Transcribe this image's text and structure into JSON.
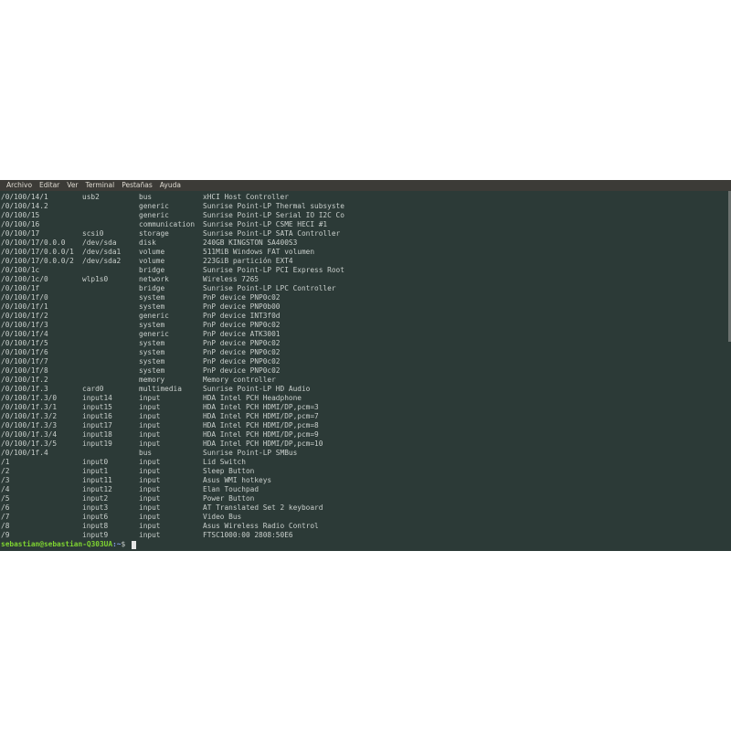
{
  "menu": [
    "Archivo",
    "Editar",
    "Ver",
    "Terminal",
    "Pestañas",
    "Ayuda"
  ],
  "rows": [
    [
      "/0/100/14/1",
      "usb2",
      "bus",
      "xHCI Host Controller"
    ],
    [
      "/0/100/14.2",
      "",
      "generic",
      "Sunrise Point-LP Thermal subsyste"
    ],
    [
      "/0/100/15",
      "",
      "generic",
      "Sunrise Point-LP Serial IO I2C Co"
    ],
    [
      "/0/100/16",
      "",
      "communication",
      "Sunrise Point-LP CSME HECI #1"
    ],
    [
      "/0/100/17",
      "scsi0",
      "storage",
      "Sunrise Point-LP SATA Controller"
    ],
    [
      "/0/100/17/0.0.0",
      "/dev/sda",
      "disk",
      "240GB KINGSTON SA400S3"
    ],
    [
      "/0/100/17/0.0.0/1",
      "/dev/sda1",
      "volume",
      "511MiB Windows FAT volumen"
    ],
    [
      "/0/100/17/0.0.0/2",
      "/dev/sda2",
      "volume",
      "223GiB partición EXT4"
    ],
    [
      "/0/100/1c",
      "",
      "bridge",
      "Sunrise Point-LP PCI Express Root"
    ],
    [
      "/0/100/1c/0",
      "wlp1s0",
      "network",
      "Wireless 7265"
    ],
    [
      "/0/100/1f",
      "",
      "bridge",
      "Sunrise Point-LP LPC Controller"
    ],
    [
      "/0/100/1f/0",
      "",
      "system",
      "PnP device PNP0c02"
    ],
    [
      "/0/100/1f/1",
      "",
      "system",
      "PnP device PNP0b00"
    ],
    [
      "/0/100/1f/2",
      "",
      "generic",
      "PnP device INT3f0d"
    ],
    [
      "/0/100/1f/3",
      "",
      "system",
      "PnP device PNP0c02"
    ],
    [
      "/0/100/1f/4",
      "",
      "generic",
      "PnP device ATK3001"
    ],
    [
      "/0/100/1f/5",
      "",
      "system",
      "PnP device PNP0c02"
    ],
    [
      "/0/100/1f/6",
      "",
      "system",
      "PnP device PNP0c02"
    ],
    [
      "/0/100/1f/7",
      "",
      "system",
      "PnP device PNP0c02"
    ],
    [
      "/0/100/1f/8",
      "",
      "system",
      "PnP device PNP0c02"
    ],
    [
      "/0/100/1f.2",
      "",
      "memory",
      "Memory controller"
    ],
    [
      "/0/100/1f.3",
      "card0",
      "multimedia",
      "Sunrise Point-LP HD Audio"
    ],
    [
      "/0/100/1f.3/0",
      "input14",
      "input",
      "HDA Intel PCH Headphone"
    ],
    [
      "/0/100/1f.3/1",
      "input15",
      "input",
      "HDA Intel PCH HDMI/DP,pcm=3"
    ],
    [
      "/0/100/1f.3/2",
      "input16",
      "input",
      "HDA Intel PCH HDMI/DP,pcm=7"
    ],
    [
      "/0/100/1f.3/3",
      "input17",
      "input",
      "HDA Intel PCH HDMI/DP,pcm=8"
    ],
    [
      "/0/100/1f.3/4",
      "input18",
      "input",
      "HDA Intel PCH HDMI/DP,pcm=9"
    ],
    [
      "/0/100/1f.3/5",
      "input19",
      "input",
      "HDA Intel PCH HDMI/DP,pcm=10"
    ],
    [
      "/0/100/1f.4",
      "",
      "bus",
      "Sunrise Point-LP SMBus"
    ],
    [
      "/1",
      "input0",
      "input",
      "Lid Switch"
    ],
    [
      "/2",
      "input1",
      "input",
      "Sleep Button"
    ],
    [
      "/3",
      "input11",
      "input",
      "Asus WMI hotkeys"
    ],
    [
      "/4",
      "input12",
      "input",
      "Elan Touchpad"
    ],
    [
      "/5",
      "input2",
      "input",
      "Power Button"
    ],
    [
      "/6",
      "input3",
      "input",
      "AT Translated Set 2 keyboard"
    ],
    [
      "/7",
      "input6",
      "input",
      "Video Bus"
    ],
    [
      "/8",
      "input8",
      "input",
      "Asus Wireless Radio Control"
    ],
    [
      "/9",
      "input9",
      "input",
      "FTSC1000:00 2808:50E6"
    ]
  ],
  "prompt": {
    "user_host": "sebastian@sebastian-Q303UA",
    "path": ":~",
    "symbol": "$ "
  },
  "colors": {
    "terminal_bg": "#2c3a37",
    "text": "#c9cfcc",
    "prompt_user": "#7fd431",
    "prompt_path": "#8a9ff0"
  }
}
